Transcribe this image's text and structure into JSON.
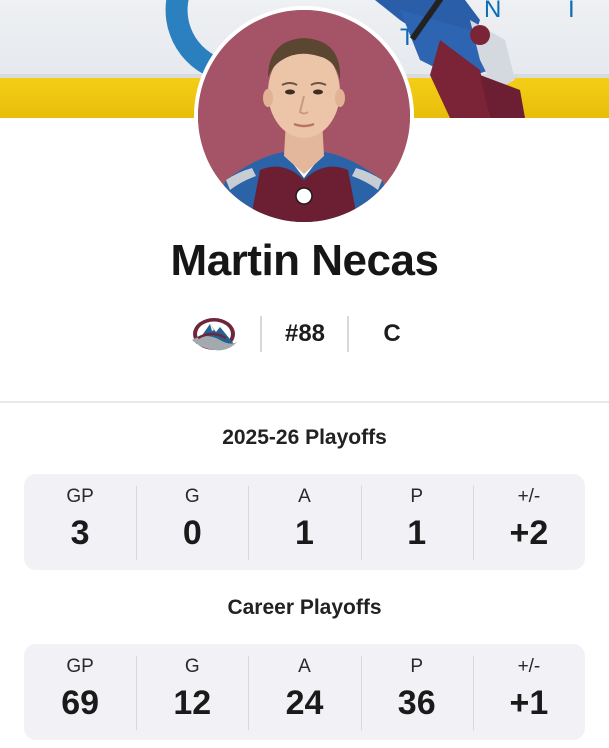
{
  "player": {
    "name": "Martin Necas",
    "jersey": "#88",
    "position": "C"
  },
  "team": {
    "logo_icon": "colorado-avalanche-logo",
    "colors": {
      "burgundy": "#6f263d",
      "blue": "#236192",
      "silver": "#a2aaad"
    }
  },
  "banner": {
    "sponsor_text": "U N I T",
    "stripe_color": "#f4cf16"
  },
  "sections": [
    {
      "title": "2025-26 Playoffs",
      "stats": [
        {
          "label": "GP",
          "value": "3"
        },
        {
          "label": "G",
          "value": "0"
        },
        {
          "label": "A",
          "value": "1"
        },
        {
          "label": "P",
          "value": "1"
        },
        {
          "label": "+/-",
          "value": "+2"
        }
      ]
    },
    {
      "title": "Career Playoffs",
      "stats": [
        {
          "label": "GP",
          "value": "69"
        },
        {
          "label": "G",
          "value": "12"
        },
        {
          "label": "A",
          "value": "24"
        },
        {
          "label": "P",
          "value": "36"
        },
        {
          "label": "+/-",
          "value": "+1"
        }
      ]
    }
  ],
  "avatar": {
    "background": "#a45466"
  }
}
